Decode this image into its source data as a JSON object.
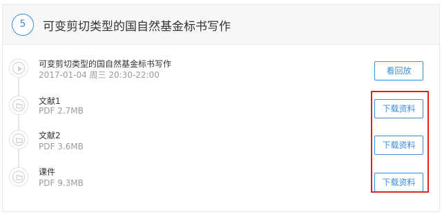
{
  "section": {
    "number": "5",
    "title": "可变剪切类型的国自然基金标书写作"
  },
  "items": [
    {
      "icon": "play-icon",
      "title": "可变剪切类型的国自然基金标书写作",
      "meta": "2017-01-04 周三 20:30-22:00",
      "button_label": "看回放"
    },
    {
      "icon": "folder-icon",
      "title": "文献1",
      "meta": "PDF 2.7MB",
      "button_label": "下载资料"
    },
    {
      "icon": "folder-icon",
      "title": "文献2",
      "meta": "PDF 3.6MB",
      "button_label": "下载资料"
    },
    {
      "icon": "folder-icon",
      "title": "课件",
      "meta": "PDF 9.3MB",
      "button_label": "下载资料"
    }
  ],
  "colors": {
    "accent": "#3a8de0",
    "highlight": "#e02020"
  }
}
